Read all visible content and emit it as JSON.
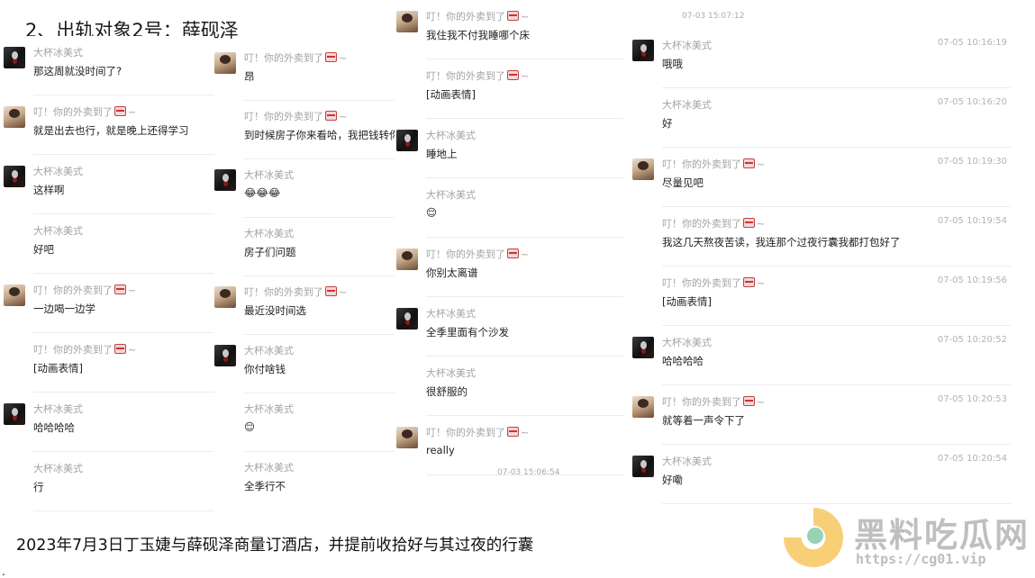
{
  "title": "2、出轨对象2号：薛砚泽",
  "caption": "2023年7月3日丁玉婕与薛砚泽商量订酒店，并提前收拾好与其过夜的行囊",
  "dot": ".",
  "names": {
    "a": "大杯冰美式",
    "b_pre": "叮！你的外卖到了",
    "b_post": "~"
  },
  "timestamps": {
    "col3_top": "07-03 15:07:12",
    "col3_bottom": "07-03 15:06:54"
  },
  "columns": [
    {
      "messages": [
        {
          "sender": "a",
          "text": "那这周就没时间了?"
        },
        {
          "sender": "b",
          "text": "就是出去也行，就是晚上还得学习"
        },
        {
          "sender": "a",
          "text": "这样啊"
        },
        {
          "sender": "a",
          "text": "好吧",
          "avatar": false
        },
        {
          "sender": "b",
          "text": "一边喝一边学"
        },
        {
          "sender": "b",
          "text": "[动画表情]",
          "avatar": false
        },
        {
          "sender": "a",
          "text": "哈哈哈哈"
        },
        {
          "sender": "a",
          "text": "行",
          "avatar": false
        }
      ]
    },
    {
      "messages": [
        {
          "sender": "b",
          "text": "昂"
        },
        {
          "sender": "b",
          "text": "到时候房子你来看哈，我把钱转你",
          "avatar": false
        },
        {
          "sender": "a",
          "text": "😂😂😂"
        },
        {
          "sender": "a",
          "text": "房子们问题",
          "avatar": false
        },
        {
          "sender": "b",
          "text": "最近没时间选"
        },
        {
          "sender": "a",
          "text": "你付啥钱"
        },
        {
          "sender": "a",
          "text": "😌",
          "avatar": false
        },
        {
          "sender": "a",
          "text": "全季行不",
          "avatar": false
        }
      ]
    },
    {
      "messages": [
        {
          "sender": "b",
          "text": "我住我不付我睡哪个床"
        },
        {
          "sender": "b",
          "text": "[动画表情]",
          "avatar": false
        },
        {
          "sender": "a",
          "text": "睡地上"
        },
        {
          "sender": "a",
          "text": "😌",
          "avatar": false
        },
        {
          "sender": "b",
          "text": "你别太离谱"
        },
        {
          "sender": "a",
          "text": "全季里面有个沙发"
        },
        {
          "sender": "a",
          "text": "很舒服的",
          "avatar": false
        },
        {
          "sender": "b",
          "text": "really"
        }
      ]
    },
    {
      "messages": [
        {
          "sender": "a",
          "time": "07-05 10:16:19",
          "text": "哦哦"
        },
        {
          "sender": "a",
          "time": "07-05 10:16:20",
          "text": "好",
          "avatar": false
        },
        {
          "sender": "b",
          "time": "07-05 10:19:30",
          "text": "尽量见吧"
        },
        {
          "sender": "b",
          "time": "07-05 10:19:54",
          "text": "我这几天熬夜苦读，我连那个过夜行囊我都打包好了",
          "avatar": false
        },
        {
          "sender": "b",
          "time": "07-05 10:19:56",
          "text": "[动画表情]",
          "avatar": false
        },
        {
          "sender": "a",
          "time": "07-05 10:20:52",
          "text": "哈哈哈哈"
        },
        {
          "sender": "b",
          "time": "07-05 10:20:53",
          "text": "就等着一声令下了"
        },
        {
          "sender": "a",
          "time": "07-05 10:20:54",
          "text": "好嘞"
        }
      ]
    }
  ],
  "watermark": {
    "name": "黑料吃瓜网",
    "url": "https://cg01.vip"
  }
}
